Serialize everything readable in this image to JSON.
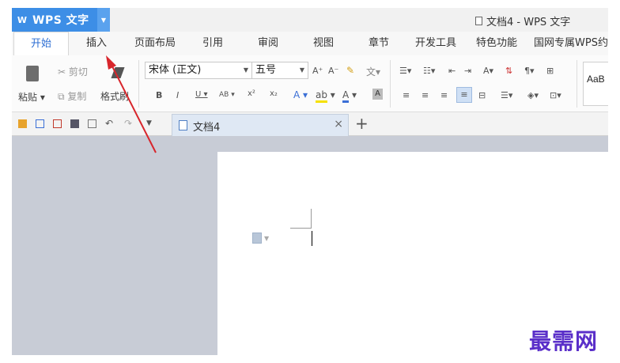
{
  "app": {
    "name": "WPS 文字",
    "window_title": "文档4 - WPS 文字"
  },
  "menu_tabs": [
    {
      "label": "开始"
    },
    {
      "label": "插入"
    },
    {
      "label": "页面布局"
    },
    {
      "label": "引用"
    },
    {
      "label": "审阅"
    },
    {
      "label": "视图"
    },
    {
      "label": "章节"
    },
    {
      "label": "开发工具"
    },
    {
      "label": "特色功能"
    },
    {
      "label": "国网专属WPS约"
    }
  ],
  "ribbon": {
    "paste": "粘贴",
    "cut": "剪切",
    "copy": "复制",
    "format_painter": "格式刷",
    "font_name": "宋体 (正文)",
    "font_size": "五号",
    "style_preview": "AaB"
  },
  "document_tab": {
    "name": "文档4"
  },
  "watermark": "最需网",
  "colors": {
    "accent": "#3d8ee6",
    "annotation_arrow": "#d8262c",
    "watermark": "#5a2fc9"
  }
}
